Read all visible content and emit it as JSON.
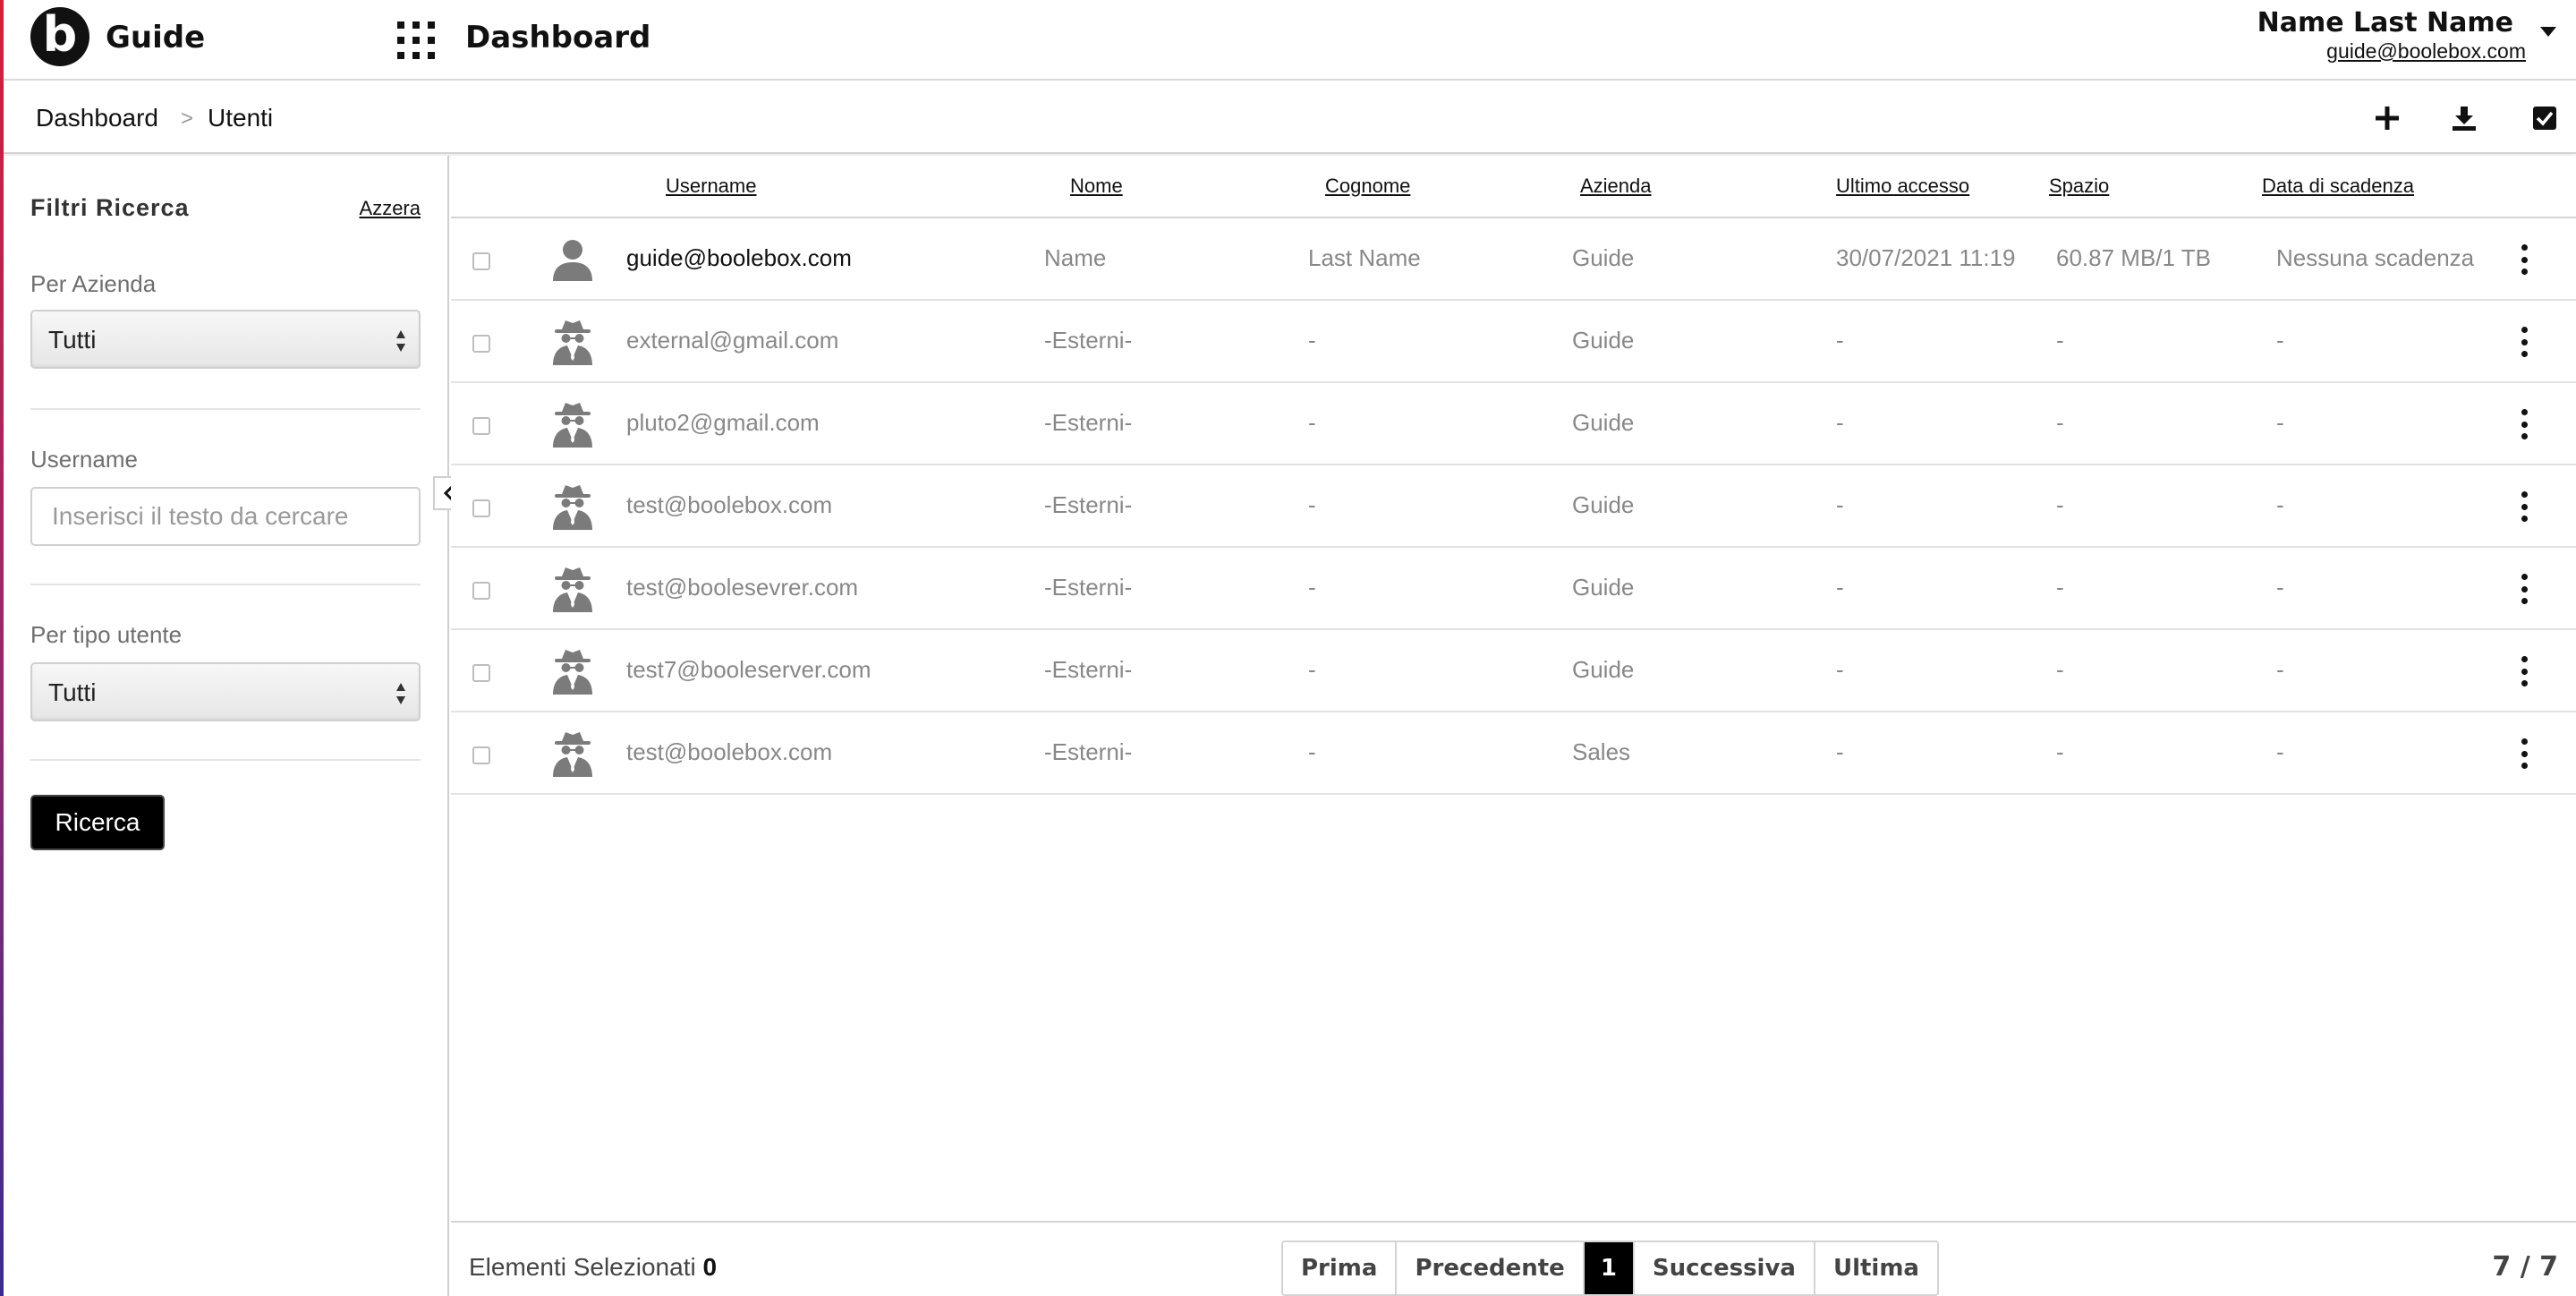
{
  "header": {
    "app_title": "Guide",
    "logo_letter": "b",
    "dashboard_title": "Dashboard",
    "user_name": "Name Last Name",
    "user_email": "guide@boolebox.com"
  },
  "breadcrumb": {
    "items": [
      "Dashboard",
      "Utenti"
    ],
    "separator": ">"
  },
  "sidebar": {
    "title": "Filtri Ricerca",
    "reset_label": "Azzera",
    "company_label": "Per Azienda",
    "company_value": "Tutti",
    "username_label": "Username",
    "username_placeholder": "Inserisci il testo da cercare",
    "username_value": "",
    "usertype_label": "Per tipo utente",
    "usertype_value": "Tutti",
    "search_button": "Ricerca"
  },
  "table": {
    "columns": [
      "Username",
      "Nome",
      "Cognome",
      "Azienda",
      "Ultimo accesso",
      "Spazio",
      "Data di scadenza"
    ],
    "rows": [
      {
        "type": "user",
        "username": "guide@boolebox.com",
        "nome": "Name",
        "cognome": "Last Name",
        "azienda": "Guide",
        "ultimo_accesso": "30/07/2021 11:19",
        "spazio": "60.87 MB/1 TB",
        "scadenza": "Nessuna scadenza"
      },
      {
        "type": "external",
        "username": "external@gmail.com",
        "nome": "-Esterni-",
        "cognome": "-",
        "azienda": "Guide",
        "ultimo_accesso": "-",
        "spazio": "-",
        "scadenza": "-"
      },
      {
        "type": "external",
        "username": "pluto2@gmail.com",
        "nome": "-Esterni-",
        "cognome": "-",
        "azienda": "Guide",
        "ultimo_accesso": "-",
        "spazio": "-",
        "scadenza": "-"
      },
      {
        "type": "external",
        "username": "test@boolebox.com",
        "nome": "-Esterni-",
        "cognome": "-",
        "azienda": "Guide",
        "ultimo_accesso": "-",
        "spazio": "-",
        "scadenza": "-"
      },
      {
        "type": "external",
        "username": "test@boolesevrer.com",
        "nome": "-Esterni-",
        "cognome": "-",
        "azienda": "Guide",
        "ultimo_accesso": "-",
        "spazio": "-",
        "scadenza": "-"
      },
      {
        "type": "external",
        "username": "test7@booleserver.com",
        "nome": "-Esterni-",
        "cognome": "-",
        "azienda": "Guide",
        "ultimo_accesso": "-",
        "spazio": "-",
        "scadenza": "-"
      },
      {
        "type": "external",
        "username": "test@boolebox.com",
        "nome": "-Esterni-",
        "cognome": "-",
        "azienda": "Sales",
        "ultimo_accesso": "-",
        "spazio": "-",
        "scadenza": "-"
      }
    ]
  },
  "footer": {
    "selected_label": "Elementi Selezionati",
    "selected_count": "0",
    "pager": {
      "first": "Prima",
      "prev": "Precedente",
      "current": "1",
      "next": "Successiva",
      "last": "Ultima"
    },
    "total": "7 / 7"
  },
  "icons": {
    "logo": "boolebox-logo",
    "apps": "apps-grid-icon",
    "caret": "caret-down-icon",
    "add": "plus-icon",
    "download": "download-icon",
    "select_all": "checkbox-checked-icon",
    "collapse": "chevron-left-icon",
    "user": "user-icon",
    "external": "spy-icon",
    "row_menu": "more-vertical-icon"
  },
  "colors": {
    "primary": "#000000",
    "muted_text": "#888888",
    "border": "#d4d4d4"
  }
}
